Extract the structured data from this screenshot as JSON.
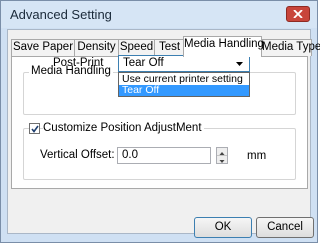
{
  "window": {
    "title": "Advanced Setting"
  },
  "tabs": [
    "Save Paper",
    "Density",
    "Speed",
    "Test",
    "Media Handling",
    "Media Type"
  ],
  "active_tab": "Media Handling",
  "media_handling": {
    "group_title": "Media Handling",
    "post_print_label": "Post-Print",
    "post_print_value": "Tear Off",
    "options": [
      "Use current printer setting",
      "Tear Off"
    ],
    "selected_option": "Tear Off"
  },
  "position": {
    "checkbox_label": "Customize Position AdjustMent",
    "checked": true,
    "vertical_offset_label": "Vertical Offset:",
    "vertical_offset_value": "0.0",
    "unit": "mm"
  },
  "buttons": {
    "ok": "OK",
    "cancel": "Cancel"
  },
  "colors": {
    "selection": "#3399ff",
    "close_button": "#c8453b",
    "title_bar": "#d6e5f5"
  }
}
